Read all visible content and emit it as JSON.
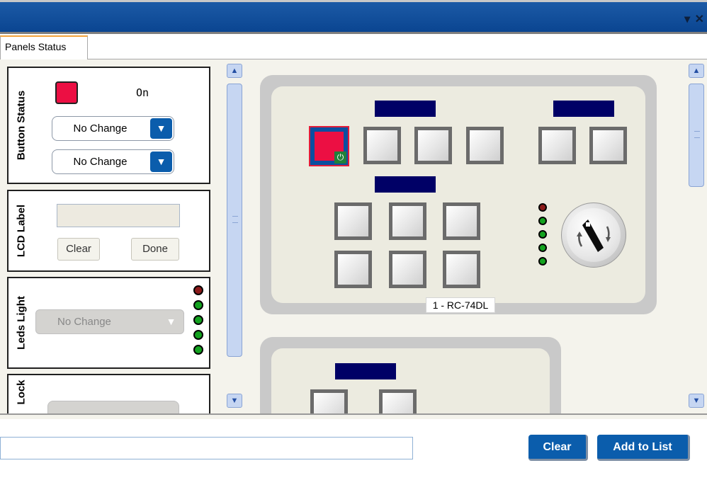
{
  "window": {
    "title_bar_icons": [
      "dropdown-arrow-icon",
      "close-icon"
    ]
  },
  "tab": {
    "label": "Panels Status"
  },
  "button_status": {
    "title": "Button Status",
    "color": "#ec0f43",
    "state_text": "On",
    "dropdown1": "No Change",
    "dropdown2": "No Change"
  },
  "lcd_label": {
    "title": "LCD Label",
    "input_value": "",
    "clear_label": "Clear",
    "done_label": "Done"
  },
  "leds_light": {
    "title": "Leds Light",
    "dropdown": "No Change",
    "leds": [
      "red",
      "green",
      "green",
      "green",
      "green"
    ]
  },
  "lock": {
    "title": "Lock"
  },
  "device1": {
    "caption": "1 - RC-74DL",
    "leds": [
      "red",
      "green",
      "green",
      "green",
      "green"
    ]
  },
  "bottom": {
    "input_value": "",
    "clear_label": "Clear",
    "add_label": "Add to List"
  }
}
